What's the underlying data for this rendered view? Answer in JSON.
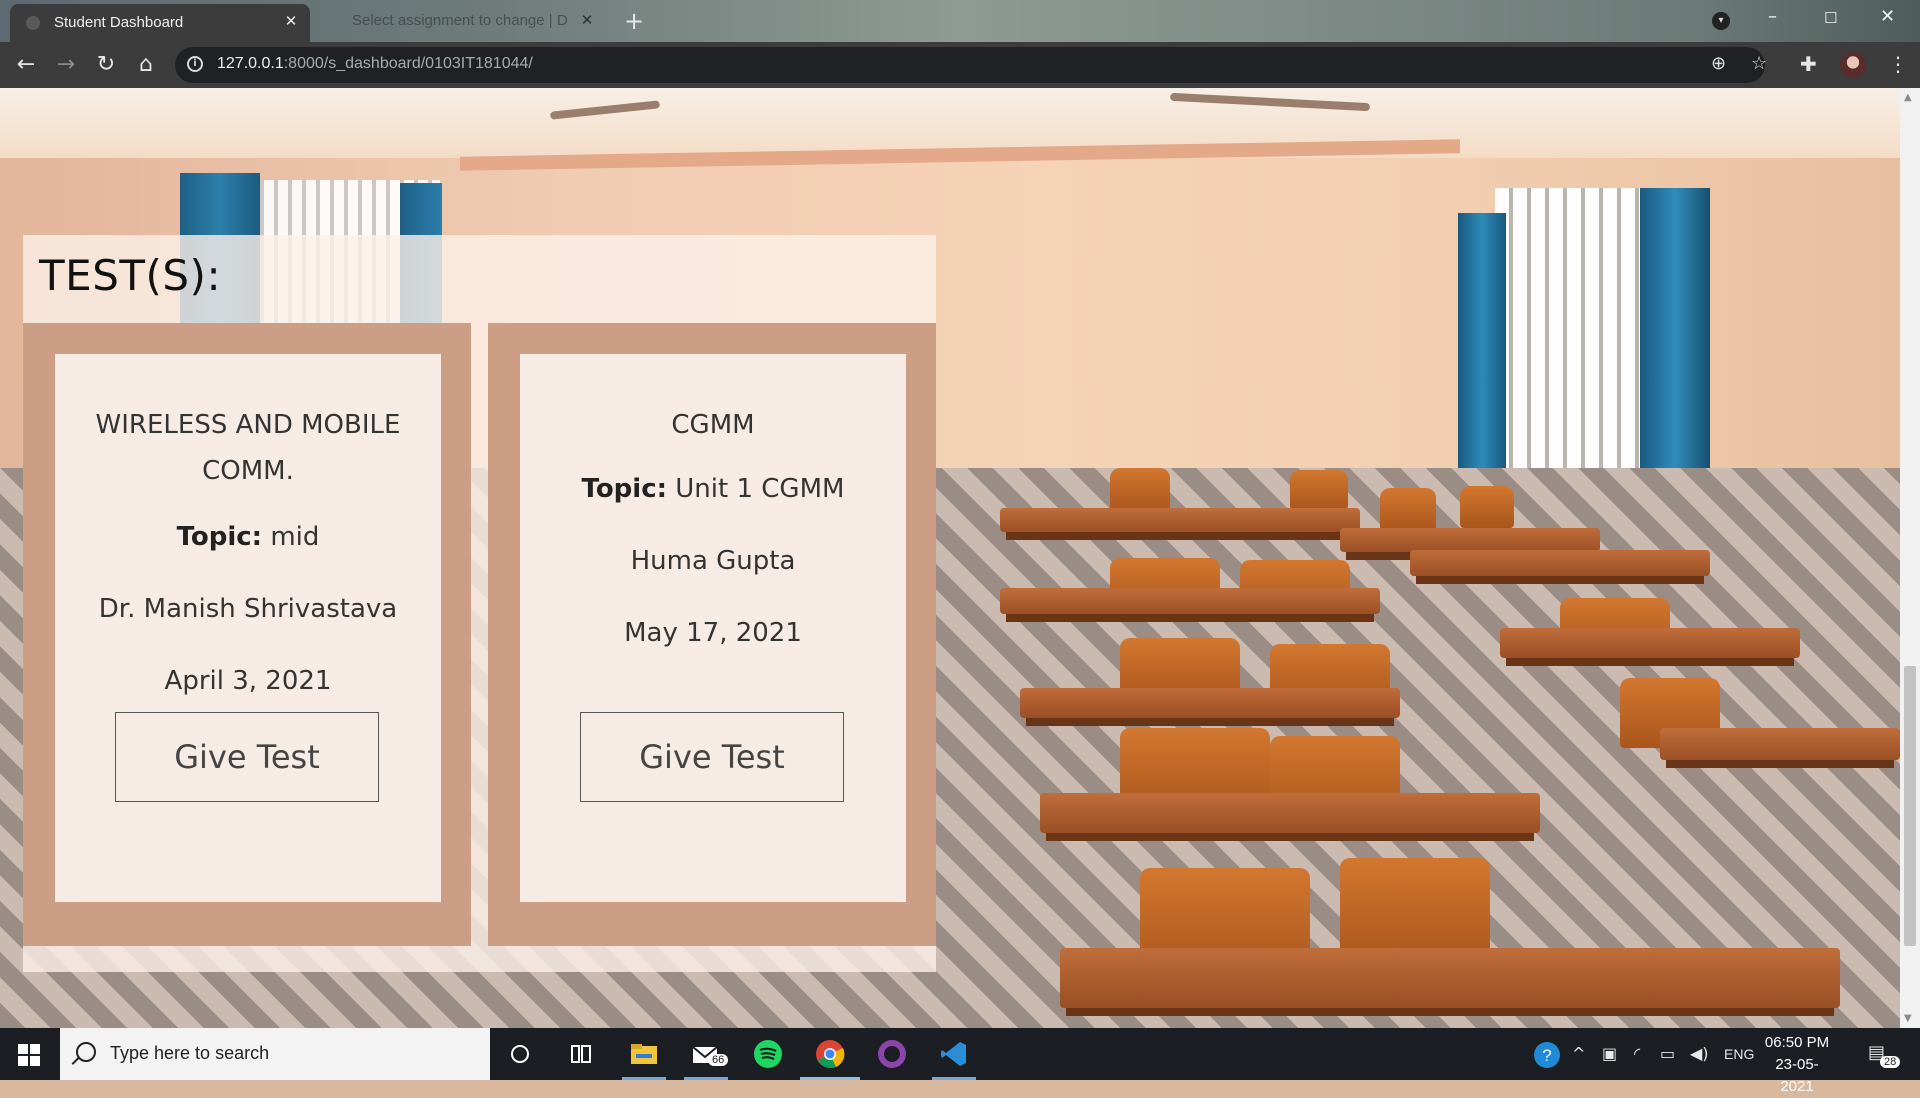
{
  "browser": {
    "active_tab": "Student Dashboard",
    "inactive_tab": "Select assignment to change | D",
    "url_host": "127.0.0.1",
    "url_path": ":8000/s_dashboard/0103IT181044/"
  },
  "panel": {
    "title": "TEST(S):",
    "tests": [
      {
        "subject": "WIRELESS AND MOBILE COMM.",
        "topic_label": "Topic:",
        "topic": "mid",
        "teacher": "Dr. Manish Shrivastava",
        "date": "April 3, 2021",
        "button": "Give Test"
      },
      {
        "subject": "CGMM",
        "topic_label": "Topic:",
        "topic": "Unit 1 CGMM",
        "teacher": "Huma Gupta",
        "date": "May 17, 2021",
        "button": "Give Test"
      }
    ]
  },
  "taskbar": {
    "search_placeholder": "Type here to search",
    "mail_badge": "66",
    "language": "ENG",
    "time": "06:50 PM",
    "date": "23-05-2021",
    "notifications": "28"
  },
  "colors": {
    "card_outer": "#cb9e85",
    "panel_bg": "#fcf0e8",
    "taskbar": "#1b1f24",
    "chrome_toolbar": "#3c3c3c"
  }
}
